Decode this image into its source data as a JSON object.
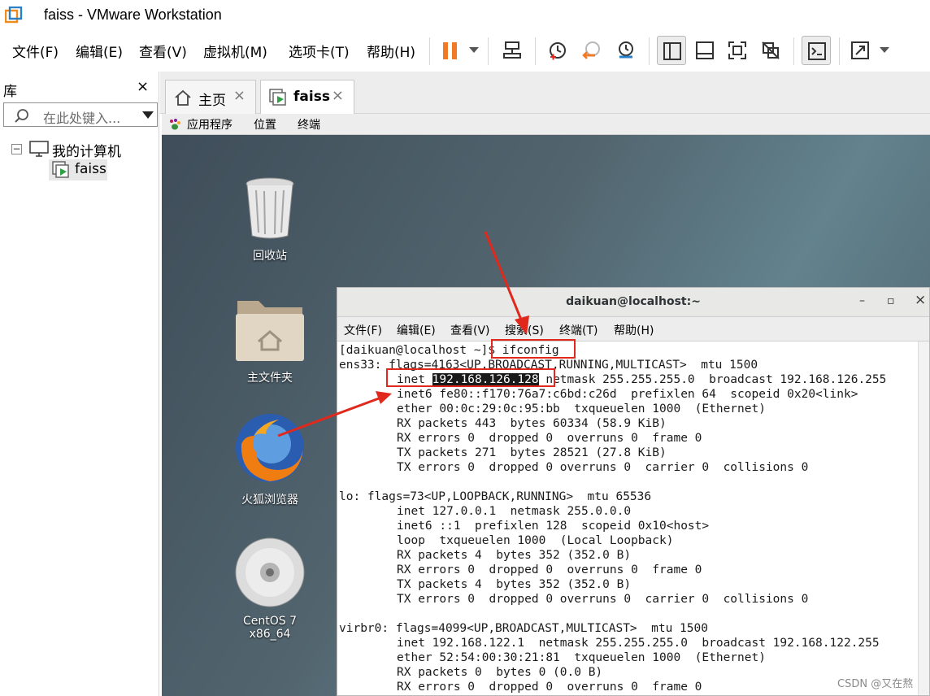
{
  "window": {
    "title": "faiss - VMware Workstation"
  },
  "menu": {
    "file": "文件(F)",
    "edit": "编辑(E)",
    "view": "查看(V)",
    "vm": "虚拟机(M)",
    "tabs": "选项卡(T)",
    "help": "帮助(H)"
  },
  "library": {
    "title": "库",
    "close": "×",
    "search_placeholder": "在此处键入...",
    "tree_toggle": "−",
    "root_label": "我的计算机",
    "child_label": "faiss"
  },
  "tabs": [
    {
      "label": "主页",
      "close": "×"
    },
    {
      "label": "faiss",
      "close": "×"
    }
  ],
  "guest_panel": {
    "apps": "应用程序",
    "places": "位置",
    "terminal": "终端"
  },
  "desktop_icons": [
    {
      "label": "回收站"
    },
    {
      "label": "主文件夹"
    },
    {
      "label": "火狐浏览器"
    },
    {
      "label": "CentOS 7 x86_64"
    }
  ],
  "terminal": {
    "title": "daikuan@localhost:~",
    "controls": {
      "minimize": "–",
      "maximize": "▫",
      "close": "×"
    },
    "menu": {
      "file": "文件(F)",
      "edit": "编辑(E)",
      "view": "查看(V)",
      "search": "搜索(S)",
      "terminal": "终端(T)",
      "help": "帮助(H)"
    },
    "prompt": "[daikuan@localhost ~]$ ",
    "command": "ifconfig",
    "inet_prefix": "inet ",
    "inet_ip": "192.168.126.128",
    "inet_rest": " netmask 255.255.255.0  broadcast 192.168.126.255",
    "lines": {
      "ens33": "ens33: flags=4163<UP,BROADCAST,RUNNING,MULTICAST>  mtu 1500",
      "ens33_inet6": "inet6 fe80::f170:76a7:c6bd:c26d  prefixlen 64  scopeid 0x20<link>",
      "ens33_ether": "ether 00:0c:29:0c:95:bb  txqueuelen 1000  (Ethernet)",
      "ens33_rxp": "RX packets 443  bytes 60334 (58.9 KiB)",
      "ens33_rxe": "RX errors 0  dropped 0  overruns 0  frame 0",
      "ens33_txp": "TX packets 271  bytes 28521 (27.8 KiB)",
      "ens33_txe": "TX errors 0  dropped 0 overruns 0  carrier 0  collisions 0",
      "lo": "lo: flags=73<UP,LOOPBACK,RUNNING>  mtu 65536",
      "lo_inet": "inet 127.0.0.1  netmask 255.0.0.0",
      "lo_inet6": "inet6 ::1  prefixlen 128  scopeid 0x10<host>",
      "lo_loop": "loop  txqueuelen 1000  (Local Loopback)",
      "lo_rxp": "RX packets 4  bytes 352 (352.0 B)",
      "lo_rxe": "RX errors 0  dropped 0  overruns 0  frame 0",
      "lo_txp": "TX packets 4  bytes 352 (352.0 B)",
      "lo_txe": "TX errors 0  dropped 0 overruns 0  carrier 0  collisions 0",
      "virbr0": "virbr0: flags=4099<UP,BROADCAST,MULTICAST>  mtu 1500",
      "virbr0_inet": "inet 192.168.122.1  netmask 255.255.255.0  broadcast 192.168.122.255",
      "virbr0_ether": "ether 52:54:00:30:21:81  txqueuelen 1000  (Ethernet)",
      "virbr0_rxp": "RX packets 0  bytes 0 (0.0 B)",
      "virbr0_rxe": "RX errors 0  dropped 0  overruns 0  frame 0"
    }
  },
  "watermark": "CSDN @又在熬",
  "colors": {
    "annotation": "#e0291c",
    "pause": "#f07a26"
  }
}
